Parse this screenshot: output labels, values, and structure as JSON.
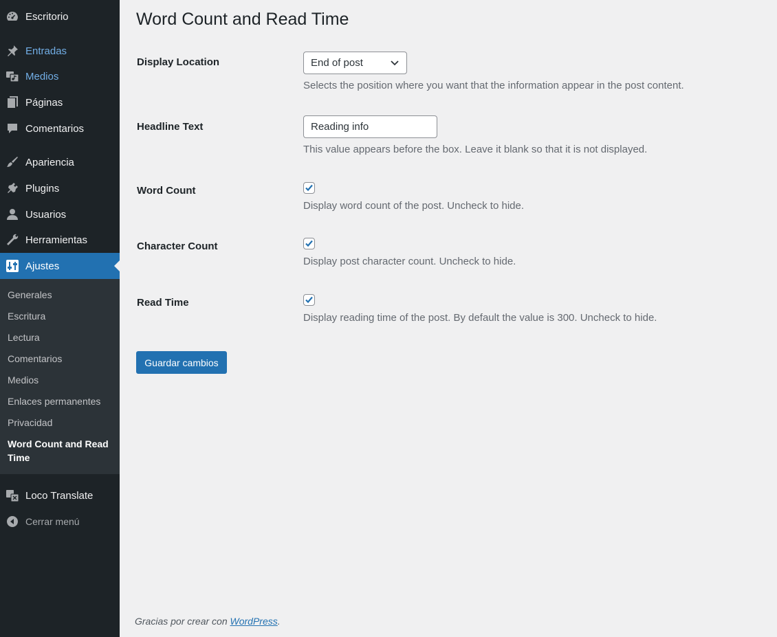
{
  "sidebar": {
    "items": [
      {
        "label": "Escritorio",
        "icon": "dashboard-icon"
      },
      {
        "label": "Entradas",
        "icon": "pin-icon"
      },
      {
        "label": "Medios",
        "icon": "media-icon"
      },
      {
        "label": "Páginas",
        "icon": "pages-icon"
      },
      {
        "label": "Comentarios",
        "icon": "comments-icon"
      },
      {
        "label": "Apariencia",
        "icon": "brush-icon"
      },
      {
        "label": "Plugins",
        "icon": "plug-icon"
      },
      {
        "label": "Usuarios",
        "icon": "user-icon"
      },
      {
        "label": "Herramientas",
        "icon": "wrench-icon"
      },
      {
        "label": "Ajustes",
        "icon": "settings-sliders-icon"
      },
      {
        "label": "Loco Translate",
        "icon": "translate-icon"
      },
      {
        "label": "Cerrar menú",
        "icon": "collapse-arrow-icon"
      }
    ],
    "submenu": [
      {
        "label": "Generales"
      },
      {
        "label": "Escritura"
      },
      {
        "label": "Lectura"
      },
      {
        "label": "Comentarios"
      },
      {
        "label": "Medios"
      },
      {
        "label": "Enlaces permanentes"
      },
      {
        "label": "Privacidad"
      },
      {
        "label": "Word Count and Read Time"
      }
    ]
  },
  "page": {
    "title": "Word Count and Read Time"
  },
  "fields": {
    "display_location": {
      "label": "Display Location",
      "value": "End of post",
      "description": "Selects the position where you want that the information appear in the post content."
    },
    "headline_text": {
      "label": "Headline Text",
      "value": "Reading info",
      "description": "This value appears before the box. Leave it blank so that it is not displayed."
    },
    "word_count": {
      "label": "Word Count",
      "checked": true,
      "description": "Display word count of the post. Uncheck to hide."
    },
    "character_count": {
      "label": "Character Count",
      "checked": true,
      "description": "Display post character count. Uncheck to hide."
    },
    "read_time": {
      "label": "Read Time",
      "checked": true,
      "description": "Display reading time of the post. By default the value is 300. Uncheck to hide."
    }
  },
  "save_button": "Guardar cambios",
  "footer": {
    "text": "Gracias por crear con ",
    "link": "WordPress",
    "suffix": "."
  },
  "colors": {
    "sidebar_bg": "#1d2327",
    "submenu_bg": "#2c3338",
    "accent": "#2271b1",
    "link_blue": "#72aee6",
    "page_bg": "#f0f0f1"
  }
}
